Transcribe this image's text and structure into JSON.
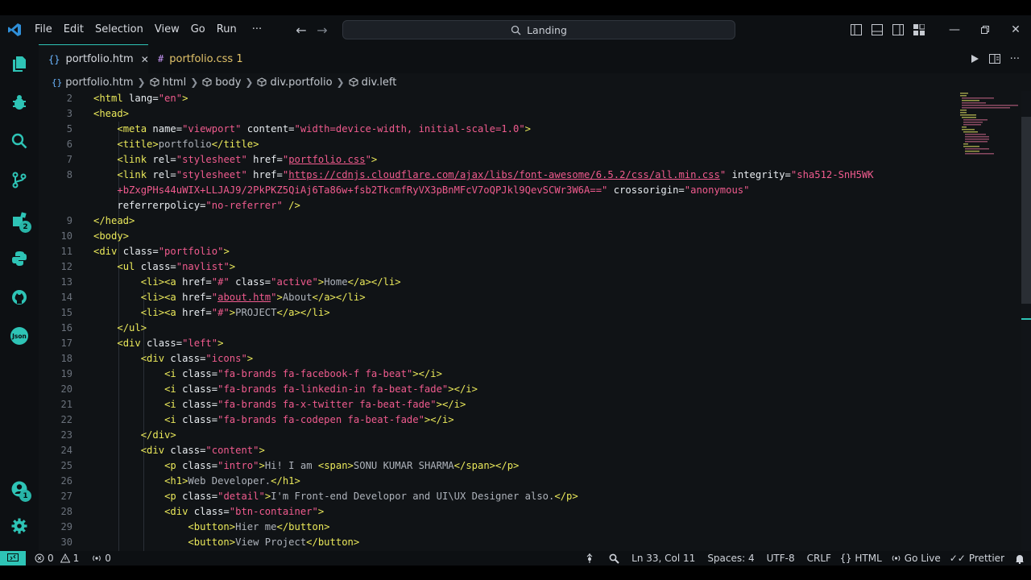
{
  "menu": [
    "File",
    "Edit",
    "Selection",
    "View",
    "Go",
    "Run",
    "···"
  ],
  "search": {
    "text": "Landing"
  },
  "tabs": [
    {
      "label": "portfolio.htm",
      "icon": "{}",
      "close": "✕",
      "color": "#d7dae0",
      "icon_color": "#6bb6ff"
    },
    {
      "label": "portfolio.css 1",
      "icon": "#",
      "color": "#e2c36a",
      "icon_color": "#c695f5"
    }
  ],
  "breadcrumb": [
    "portfolio.htm",
    "html",
    "body",
    "div.portfolio",
    "div.left"
  ],
  "activity_badges": {
    "extensions": "2",
    "accounts": "1"
  },
  "line_numbers": [
    "2",
    "3",
    "5",
    "6",
    "7",
    "8",
    "",
    "",
    "9",
    "10",
    "11",
    "12",
    "13",
    "14",
    "15",
    "16",
    "17",
    "18",
    "19",
    "20",
    "21",
    "22",
    "23",
    "24",
    "25",
    "26",
    "27",
    "28",
    "29",
    "30"
  ],
  "code_lines": [
    [
      [
        "t",
        "<html "
      ],
      [
        "a",
        "lang="
      ],
      [
        "s",
        "\"en\""
      ],
      [
        "t",
        ">"
      ]
    ],
    [
      [
        "t",
        "<head>"
      ]
    ],
    [
      [
        "x",
        "    "
      ],
      [
        "t",
        "<meta "
      ],
      [
        "a",
        "name="
      ],
      [
        "s",
        "\"viewport\""
      ],
      [
        "a",
        " content="
      ],
      [
        "s",
        "\"width=device-width, initial-scale=1.0\""
      ],
      [
        "t",
        ">"
      ]
    ],
    [
      [
        "x",
        "    "
      ],
      [
        "t",
        "<title>"
      ],
      [
        "x",
        "portfolio"
      ],
      [
        "t",
        "</title>"
      ]
    ],
    [
      [
        "x",
        "    "
      ],
      [
        "t",
        "<link "
      ],
      [
        "a",
        "rel="
      ],
      [
        "s",
        "\"stylesheet\""
      ],
      [
        "a",
        " href="
      ],
      [
        "s",
        "\""
      ],
      [
        "u",
        "portfolio.css"
      ],
      [
        "s",
        "\""
      ],
      [
        "t",
        ">"
      ]
    ],
    [
      [
        "x",
        "    "
      ],
      [
        "t",
        "<link "
      ],
      [
        "a",
        "rel="
      ],
      [
        "s",
        "\"stylesheet\""
      ],
      [
        "a",
        " href="
      ],
      [
        "s",
        "\""
      ],
      [
        "u",
        "https://cdnjs.cloudflare.com/ajax/libs/font-awesome/6.5.2/css/all.min.css"
      ],
      [
        "s",
        "\""
      ],
      [
        "a",
        " integrity="
      ],
      [
        "s",
        "\"sha512-SnH5WK"
      ]
    ],
    [
      [
        "x",
        "    "
      ],
      [
        "s",
        "+bZxgPHs44uWIX+LLJAJ9/2PkPKZ5QiAj6Ta86w+fsb2TkcmfRyVX3pBnMFcV7oQPJkl9QevSCWr3W6A==\""
      ],
      [
        "a",
        " crossorigin="
      ],
      [
        "s",
        "\"anonymous\""
      ]
    ],
    [
      [
        "x",
        "    "
      ],
      [
        "a",
        "referrerpolicy="
      ],
      [
        "s",
        "\"no-referrer\""
      ],
      [
        "t",
        " />"
      ]
    ],
    [
      [
        "t",
        "</head>"
      ]
    ],
    [
      [
        "t",
        "<body>"
      ]
    ],
    [
      [
        "t",
        "<div "
      ],
      [
        "a",
        "class="
      ],
      [
        "s",
        "\"portfolio\""
      ],
      [
        "t",
        ">"
      ]
    ],
    [
      [
        "x",
        "    "
      ],
      [
        "t",
        "<ul "
      ],
      [
        "a",
        "class="
      ],
      [
        "s",
        "\"navlist\""
      ],
      [
        "t",
        ">"
      ]
    ],
    [
      [
        "x",
        "        "
      ],
      [
        "t",
        "<li><a "
      ],
      [
        "a",
        "href="
      ],
      [
        "s",
        "\"#\""
      ],
      [
        "a",
        " class="
      ],
      [
        "s",
        "\"active\""
      ],
      [
        "t",
        ">"
      ],
      [
        "x",
        "Home"
      ],
      [
        "t",
        "</a></li>"
      ]
    ],
    [
      [
        "x",
        "        "
      ],
      [
        "t",
        "<li><a "
      ],
      [
        "a",
        "href="
      ],
      [
        "s",
        "\""
      ],
      [
        "u",
        "about.htm"
      ],
      [
        "s",
        "\""
      ],
      [
        "t",
        ">"
      ],
      [
        "x",
        "About"
      ],
      [
        "t",
        "</a></li>"
      ]
    ],
    [
      [
        "x",
        "        "
      ],
      [
        "t",
        "<li><a "
      ],
      [
        "a",
        "href="
      ],
      [
        "s",
        "\"#\""
      ],
      [
        "t",
        ">"
      ],
      [
        "x",
        "PROJECT"
      ],
      [
        "t",
        "</a></li>"
      ]
    ],
    [
      [
        "x",
        "    "
      ],
      [
        "t",
        "</ul>"
      ]
    ],
    [
      [
        "x",
        "    "
      ],
      [
        "t",
        "<div "
      ],
      [
        "a",
        "class="
      ],
      [
        "s",
        "\"left\""
      ],
      [
        "t",
        ">"
      ]
    ],
    [
      [
        "x",
        "        "
      ],
      [
        "t",
        "<div "
      ],
      [
        "a",
        "class="
      ],
      [
        "s",
        "\"icons\""
      ],
      [
        "t",
        ">"
      ]
    ],
    [
      [
        "x",
        "            "
      ],
      [
        "t",
        "<i "
      ],
      [
        "a",
        "class="
      ],
      [
        "s",
        "\"fa-brands fa-facebook-f fa-beat\""
      ],
      [
        "t",
        "></i>"
      ]
    ],
    [
      [
        "x",
        "            "
      ],
      [
        "t",
        "<i "
      ],
      [
        "a",
        "class="
      ],
      [
        "s",
        "\"fa-brands fa-linkedin-in fa-beat-fade\""
      ],
      [
        "t",
        "></i>"
      ]
    ],
    [
      [
        "x",
        "            "
      ],
      [
        "t",
        "<i "
      ],
      [
        "a",
        "class="
      ],
      [
        "s",
        "\"fa-brands fa-x-twitter fa-beat-fade\""
      ],
      [
        "t",
        "></i>"
      ]
    ],
    [
      [
        "x",
        "            "
      ],
      [
        "t",
        "<i "
      ],
      [
        "a",
        "class="
      ],
      [
        "s",
        "\"fa-brands fa-codepen fa-beat-fade\""
      ],
      [
        "t",
        "></i>"
      ]
    ],
    [
      [
        "x",
        "        "
      ],
      [
        "t",
        "</div>"
      ]
    ],
    [
      [
        "x",
        "        "
      ],
      [
        "t",
        "<div "
      ],
      [
        "a",
        "class="
      ],
      [
        "s",
        "\"content\""
      ],
      [
        "t",
        ">"
      ]
    ],
    [
      [
        "x",
        "            "
      ],
      [
        "t",
        "<p "
      ],
      [
        "a",
        "class="
      ],
      [
        "s",
        "\"intro\""
      ],
      [
        "t",
        ">"
      ],
      [
        "x",
        "Hi! I am "
      ],
      [
        "t",
        "<span>"
      ],
      [
        "x",
        "SONU KUMAR SHARMA"
      ],
      [
        "t",
        "</span></p>"
      ]
    ],
    [
      [
        "x",
        "            "
      ],
      [
        "t",
        "<h1>"
      ],
      [
        "x",
        "Web Developer."
      ],
      [
        "t",
        "</h1>"
      ]
    ],
    [
      [
        "x",
        "            "
      ],
      [
        "t",
        "<p "
      ],
      [
        "a",
        "class="
      ],
      [
        "s",
        "\"detail\""
      ],
      [
        "t",
        ">"
      ],
      [
        "x",
        "I'm Front-end Developor and UI\\UX Designer also."
      ],
      [
        "t",
        "</p>"
      ]
    ],
    [
      [
        "x",
        "            "
      ],
      [
        "t",
        "<div "
      ],
      [
        "a",
        "class="
      ],
      [
        "s",
        "\"btn-container\""
      ],
      [
        "t",
        ">"
      ]
    ],
    [
      [
        "x",
        "                "
      ],
      [
        "t",
        "<button>"
      ],
      [
        "x",
        "Hier me"
      ],
      [
        "t",
        "</button>"
      ]
    ],
    [
      [
        "x",
        "                "
      ],
      [
        "t",
        "<button>"
      ],
      [
        "x",
        "View Project"
      ],
      [
        "t",
        "</button>"
      ]
    ]
  ],
  "status": {
    "errors": "0",
    "warnings": "1",
    "ports": "0",
    "position": "Ln 33, Col 11",
    "spaces": "Spaces: 4",
    "encoding": "UTF-8",
    "eol": "CRLF",
    "language": "HTML",
    "live": "Go Live",
    "prettier": "Prettier"
  },
  "colors": {
    "accent": "#2ec4b6",
    "tag": "#eae85a",
    "string": "#f05b8e",
    "attr": "#e8ecf0",
    "text": "#aeb3bb"
  }
}
